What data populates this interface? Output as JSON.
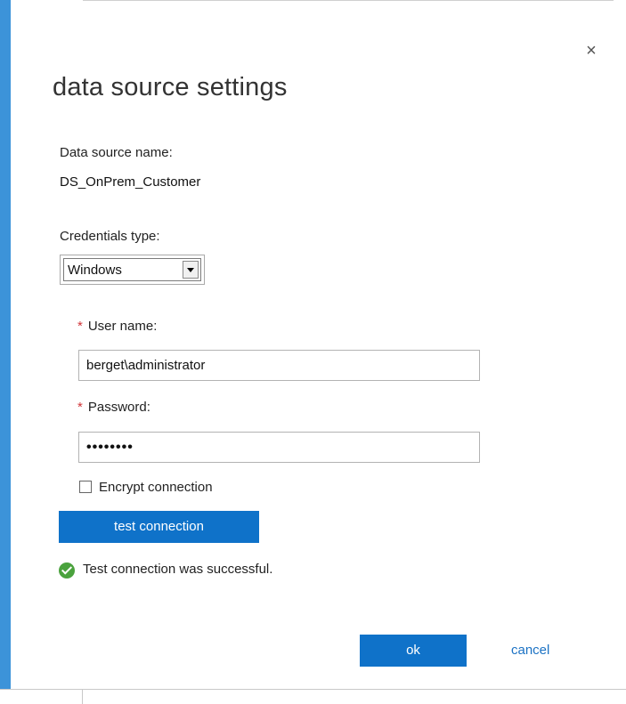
{
  "dialog": {
    "title": "data source settings",
    "close_icon": "close-icon",
    "close_glyph": "×"
  },
  "data_source": {
    "name_label": "Data source name:",
    "name_value": "DS_OnPrem_Customer"
  },
  "credentials": {
    "type_label": "Credentials type:",
    "type_selected": "Windows"
  },
  "user": {
    "required_marker": "*",
    "label": "User name:",
    "value": "berget\\administrator"
  },
  "password": {
    "required_marker": "*",
    "label": "Password:",
    "masked_value": "••••••••"
  },
  "encrypt": {
    "label": "Encrypt connection",
    "checked": false
  },
  "actions": {
    "test_connection_label": "test connection",
    "ok_label": "ok",
    "cancel_label": "cancel"
  },
  "status": {
    "icon": "success-check-icon",
    "message": "Test connection was successful."
  },
  "colors": {
    "accent_bar": "#3c93d9",
    "primary_button": "#0f72c9",
    "required_marker": "#d13438",
    "success_icon": "#4aa23d",
    "link": "#1b72c4"
  }
}
